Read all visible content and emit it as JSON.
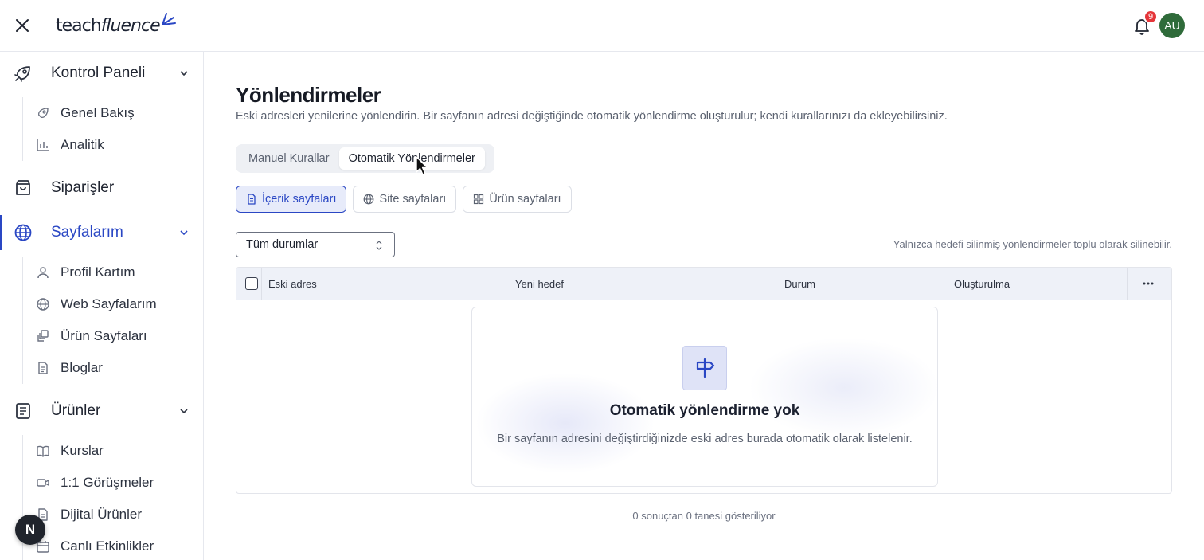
{
  "header": {
    "logo_text_a": "teach",
    "logo_text_b": "fluence",
    "notifications_count": "9",
    "avatar_initials": "AU"
  },
  "sidebar": {
    "groups": [
      {
        "label": "Kontrol Paneli",
        "icon": "rocket-icon"
      },
      {
        "label": "Siparişler",
        "icon": "shopping-bag-icon"
      },
      {
        "label": "Sayfalarım",
        "icon": "globe-icon"
      },
      {
        "label": "Ürünler",
        "icon": "document-icon"
      }
    ],
    "dashboard_items": [
      {
        "label": "Genel Bakış",
        "icon": "rocket-icon"
      },
      {
        "label": "Analitik",
        "icon": "bar-chart-icon"
      }
    ],
    "pages_items": [
      {
        "label": "Profil Kartım",
        "icon": "user-icon"
      },
      {
        "label": "Web Sayfalarım",
        "icon": "globe-icon"
      },
      {
        "label": "Ürün Sayfaları",
        "icon": "pages-icon"
      },
      {
        "label": "Bloglar",
        "icon": "document-icon"
      }
    ],
    "products_items": [
      {
        "label": "Kurslar",
        "icon": "book-icon"
      },
      {
        "label": "1:1 Görüşmeler",
        "icon": "video-icon"
      },
      {
        "label": "Dijital Ürünler",
        "icon": "file-icon"
      },
      {
        "label": "Canlı Etkinlikler",
        "icon": "calendar-icon"
      }
    ],
    "fab_label": "N"
  },
  "main": {
    "title": "Yönlendirmeler",
    "description": "Eski adresleri yenilerine yönlendirin. Bir sayfanın adresi değiştiğinde otomatik yönlendirme oluşturulur; kendi kurallarınızı da ekleyebilirsiniz.",
    "tabs": [
      {
        "label": "Manuel Kurallar",
        "selected": false
      },
      {
        "label": "Otomatik Yönlendirmeler",
        "selected": true
      }
    ],
    "chips": [
      {
        "label": "İçerik sayfaları",
        "icon": "document-icon",
        "selected": true
      },
      {
        "label": "Site sayfaları",
        "icon": "globe-icon",
        "selected": false
      },
      {
        "label": "Ürün sayfaları",
        "icon": "grid-icon",
        "selected": false
      }
    ],
    "status_select": {
      "value": "Tüm durumlar"
    },
    "hint": "Yalnızca hedefi silinmiş yönlendirmeler toplu olarak silinebilir.",
    "table": {
      "columns": [
        "Eski adres",
        "Yeni hedef",
        "Durum",
        "Oluşturulma"
      ]
    },
    "empty_state": {
      "title": "Otomatik yönlendirme yok",
      "text": "Bir sayfanın adresini değiştirdiğinizde eski adres burada otomatik olarak listelenir."
    },
    "footer": "0 sonuçtan 0 tanesi gösteriliyor"
  },
  "colors": {
    "accent": "#2a47c4",
    "accent_bg": "#e7ebfa",
    "badge": "#e5363a",
    "avatar": "#2f6b3a"
  }
}
